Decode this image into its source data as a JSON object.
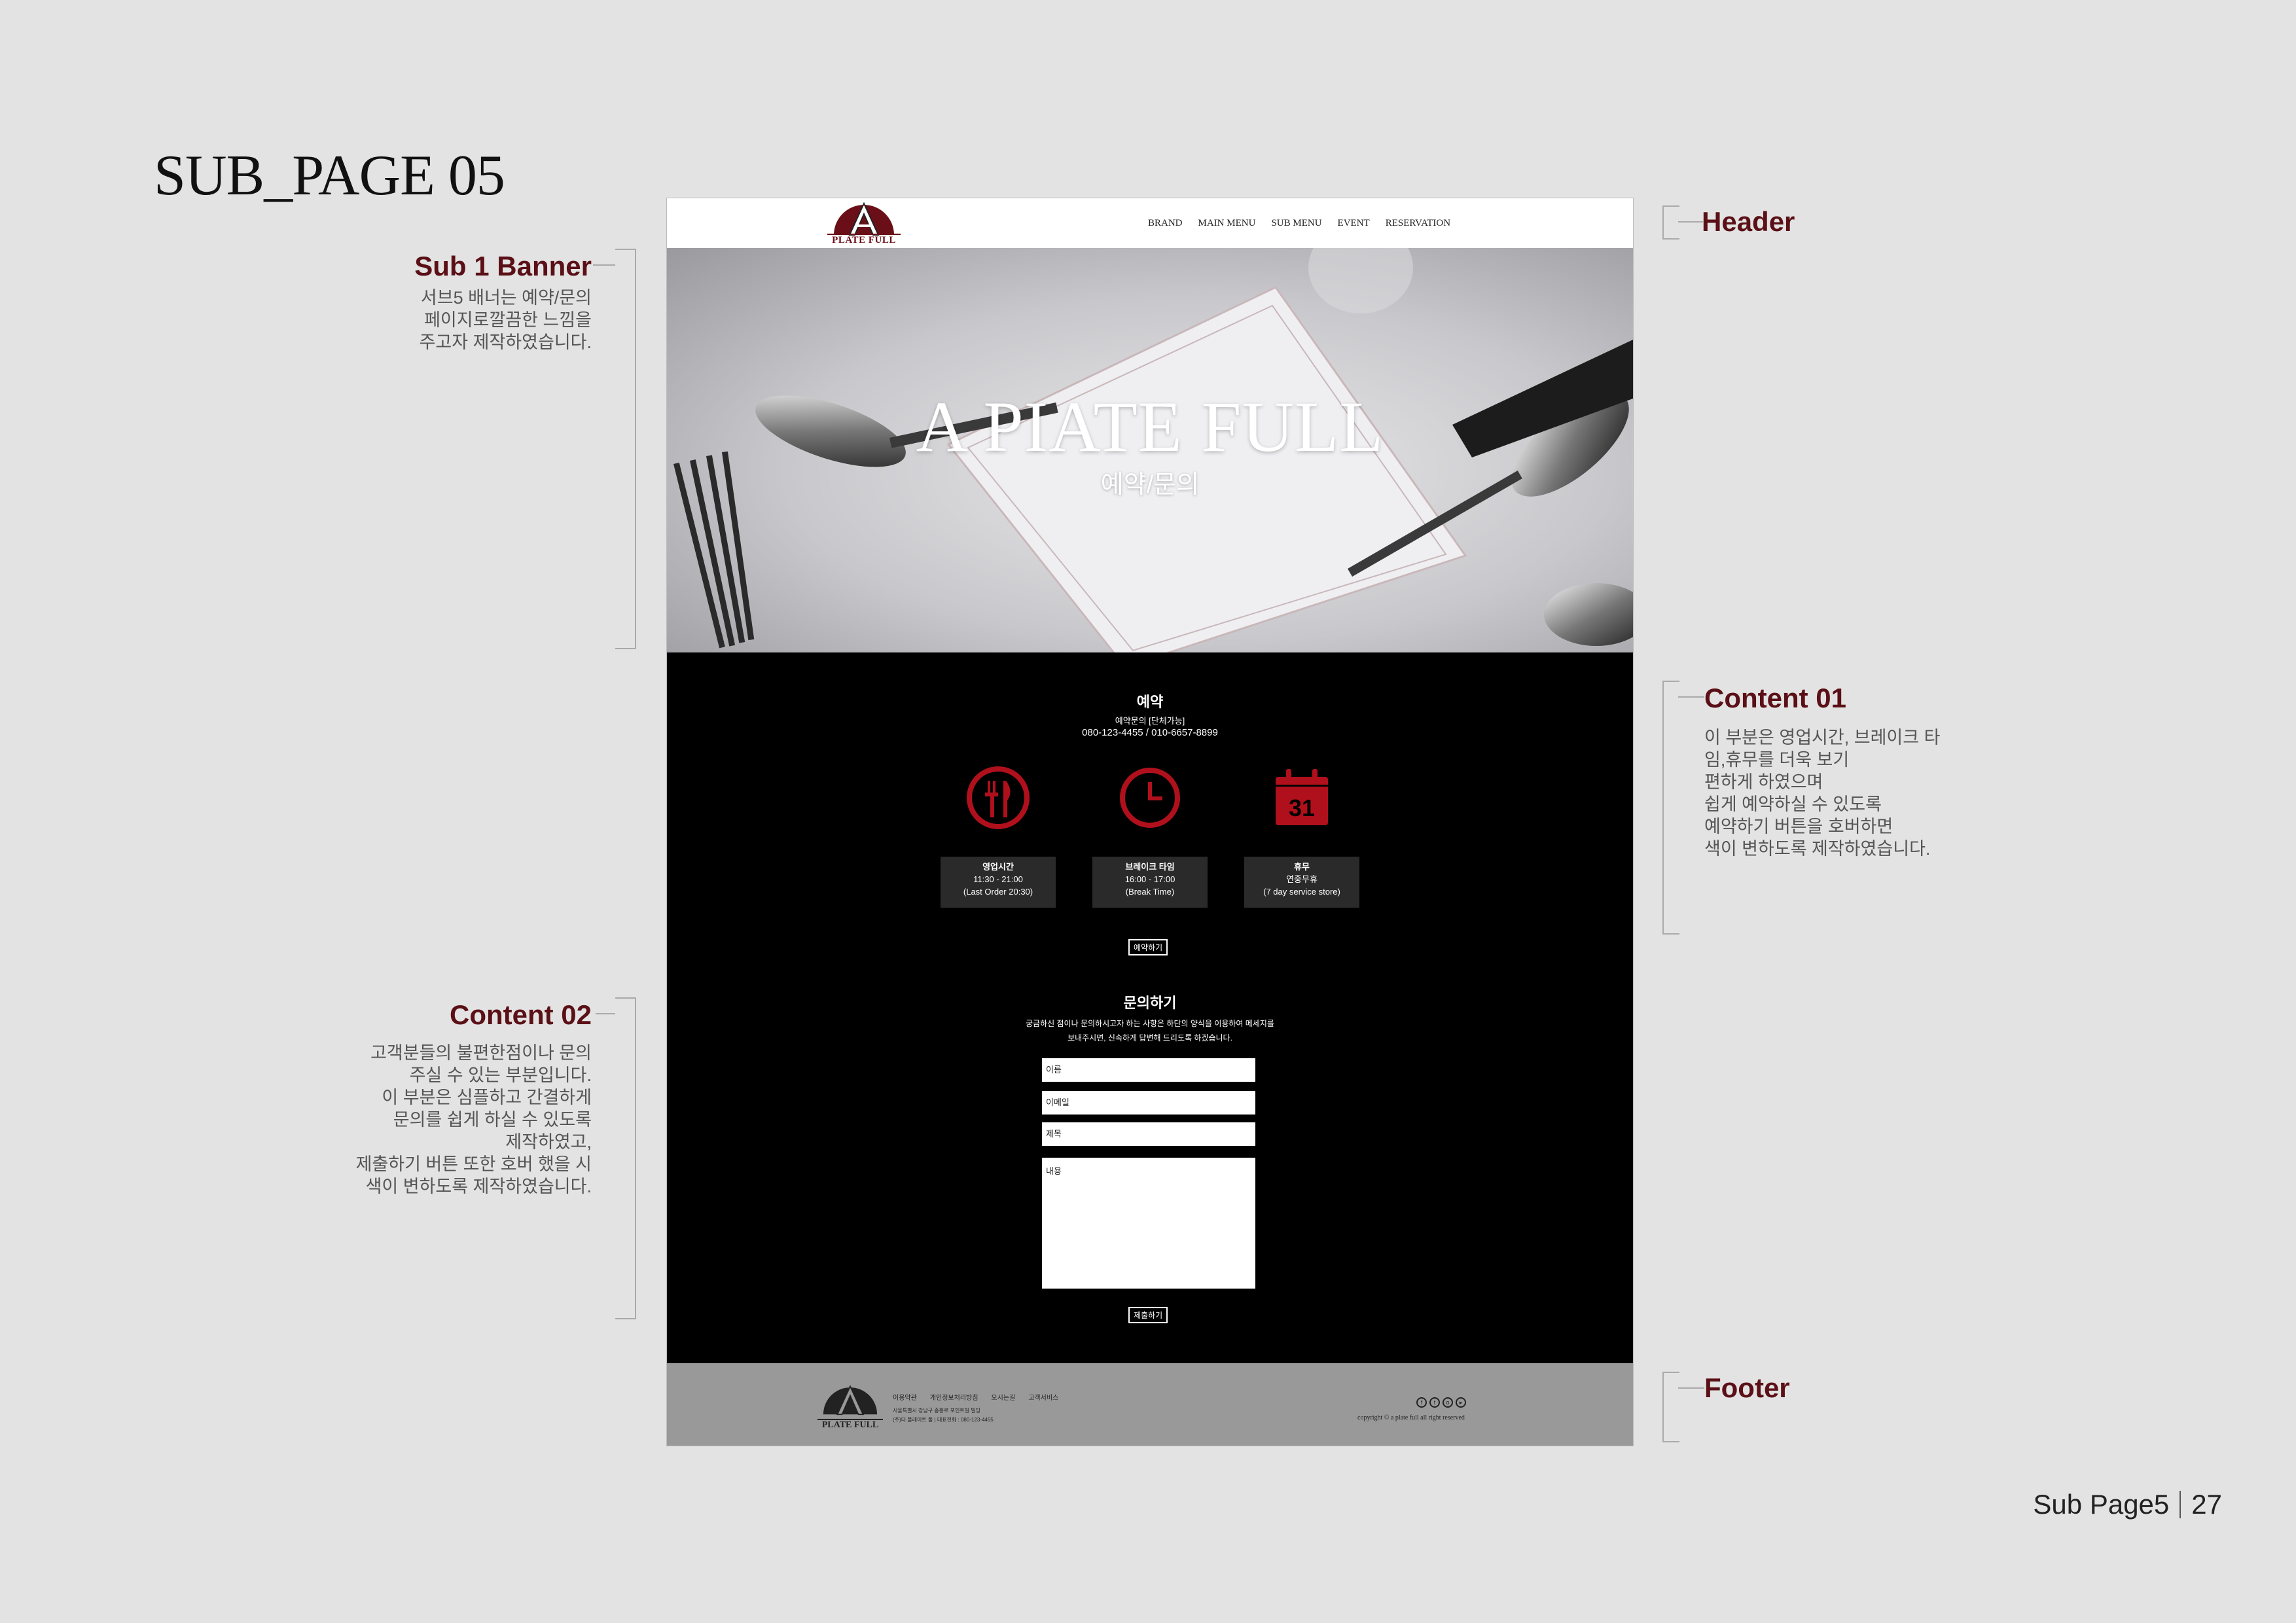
{
  "page": {
    "title": "SUB_PAGE 05",
    "footer_label": "Sub Page5",
    "page_number": "27"
  },
  "annotations": {
    "header": {
      "title": "Header"
    },
    "banner": {
      "title": "Sub 1 Banner",
      "desc": "서브5 배너는 예약/문의\n페이지로깔끔한 느낌을\n주고자 제작하였습니다."
    },
    "content01": {
      "title": "Content 01",
      "desc": "이 부분은 영업시간, 브레이크 타\n임,휴무를 더욱 보기\n 편하게 하였으며\n쉽게 예약하실 수 있도록\n예약하기 버튼을 호버하면\n색이 변하도록 제작하였습니다."
    },
    "content02": {
      "title": "Content 02",
      "desc": "고객분들의 불편한점이나 문의\n주실 수 있는 부분입니다.\n이 부분은 심플하고 간결하게\n문의를 쉽게 하실 수 있도록\n제작하였고,\n제출하기 버튼 또한 호버 했을 시\n색이 변하도록 제작하였습니다."
    },
    "footer": {
      "title": "Footer"
    }
  },
  "site": {
    "logo_text": "PLATE FULL",
    "nav": [
      "BRAND",
      "MAIN MENU",
      "SUB MENU",
      "EVENT",
      "RESERVATION"
    ],
    "banner": {
      "title": "A PIATE FULL",
      "subtitle": "예약/문의"
    },
    "reservation": {
      "title": "예약",
      "line1": "예약문의 [단체가능]",
      "phone": "080-123-4455 / 010-6657-8899",
      "calendar_day": "31",
      "boxes": [
        {
          "title": "영업시간",
          "line1": "11:30 - 21:00",
          "line2": "(Last Order 20:30)"
        },
        {
          "title": "브레이크 타임",
          "line1": "16:00 - 17:00",
          "line2": "(Break Time)"
        },
        {
          "title": "휴무",
          "line1": "연중무휴",
          "line2": "(7 day service store)"
        }
      ],
      "button": "예약하기"
    },
    "inquiry": {
      "title": "문의하기",
      "desc1": "궁금하신 점이나 문의하시고자 하는 사항은 하단의 양식을 이용하여 메세지를",
      "desc2": "보내주시면, 신속하게 답변해 드리도록 하겠습니다.",
      "name_placeholder": "이름",
      "email_placeholder": "이메일",
      "subject_placeholder": "제목",
      "message_placeholder": "내용",
      "button": "제출하기"
    },
    "footer": {
      "links": [
        "이용약관",
        "개인정보처리방침",
        "오시는길",
        "고객서비스"
      ],
      "address": "서울특별시 강남구 중흥로 포인트빌 빌딩\n(주)더 플레이트 풀 | 대표전화 : 080-123-4455",
      "copyright": "copyright © a plate full all right reserved"
    }
  },
  "colors": {
    "accent": "#b0101c",
    "annotation": "#5a1016",
    "background": "#e3e3e3"
  }
}
